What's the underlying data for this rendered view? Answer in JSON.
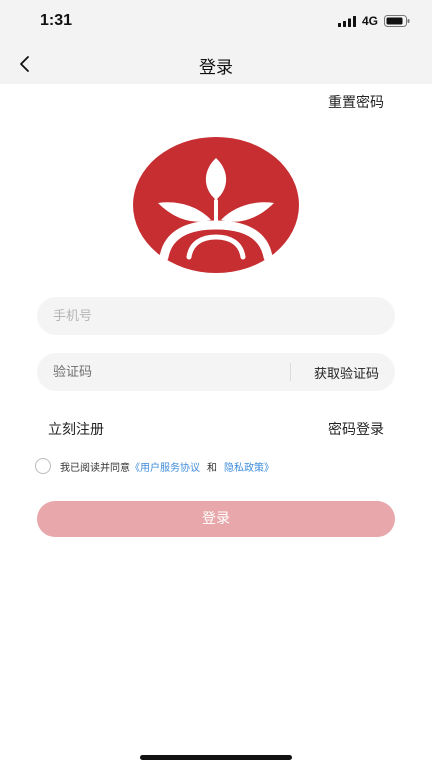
{
  "status_bar": {
    "time": "1:31",
    "network": "4G",
    "icons": [
      "signal-icon",
      "battery-icon"
    ]
  },
  "nav": {
    "title": "登录",
    "back_icon": "chevron-left-icon"
  },
  "reset_password_label": "重置密码",
  "logo": {
    "icon": "leaf-logo-icon",
    "colors": {
      "background": "#c62e31",
      "mark": "#ffffff"
    }
  },
  "form": {
    "phone_placeholder": "手机号",
    "code_placeholder": "验证码",
    "get_code_label": "获取验证码"
  },
  "links": {
    "register": "立刻注册",
    "password_login": "密码登录"
  },
  "agreement": {
    "prefix": "我已阅读并同意",
    "user_agreement": "《用户服务协议",
    "conjunction": "和",
    "privacy_policy": "隐私政策》",
    "checked": false
  },
  "login_button_label": "登录",
  "colors": {
    "accent": "#c62e31",
    "login_button": "#e8a7aa",
    "link": "#3f8ddb",
    "input_background": "#f4f4f4"
  }
}
